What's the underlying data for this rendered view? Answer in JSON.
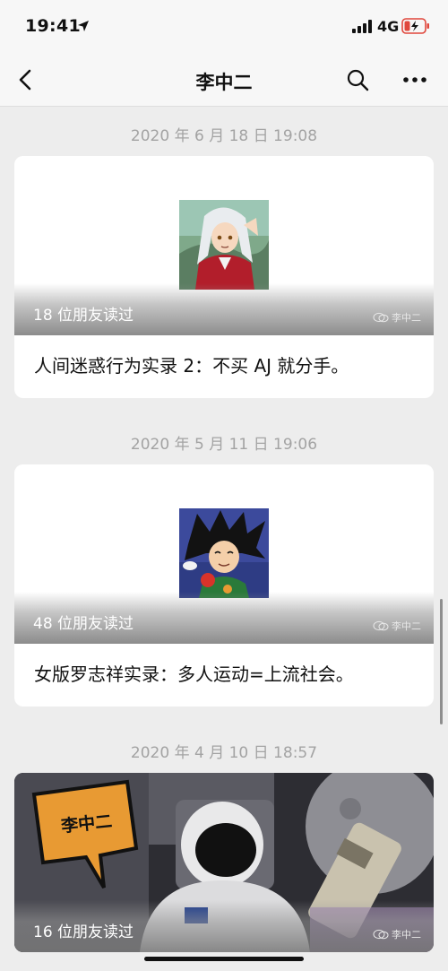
{
  "status_bar": {
    "time": "19:41",
    "network": "4G"
  },
  "nav": {
    "title": "李中二"
  },
  "feed": [
    {
      "date": "2020 年 6 月 18 日  19:08",
      "read_count": "18 位朋友读过",
      "watermark": "李中二",
      "title": "人间迷惑行为实录 2：不买 AJ 就分手。",
      "thumbnail": "inuyasha-avatar"
    },
    {
      "date": "2020 年 5 月 11 日  19:06",
      "read_count": "48 位朋友读过",
      "watermark": "李中二",
      "title": "女版罗志祥实录：多人运动=上流社会。",
      "thumbnail": "goku-avatar"
    },
    {
      "date": "2020 年 4 月 10 日  18:57",
      "read_count": "16 位朋友读过",
      "watermark": "李中二",
      "badge": "李中二",
      "title": "",
      "thumbnail": "astronaut-cover"
    }
  ],
  "icons": {
    "back": "chevron-left-icon",
    "search": "search-icon",
    "more": "more-icon"
  },
  "colors": {
    "background": "#ededed",
    "card": "#ffffff",
    "date_text": "#a3a3a3",
    "badge_orange": "#e89a33",
    "battery_red": "#e0473c"
  }
}
